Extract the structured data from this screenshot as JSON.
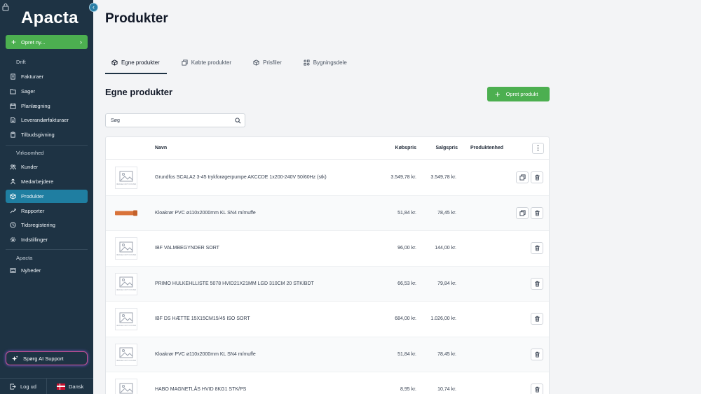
{
  "sidebar": {
    "logo": "Apacta",
    "collapse_glyph": "‹",
    "create_label": "Opret ny...",
    "sections": [
      {
        "label": "Drift"
      },
      {
        "label": "Virksomhed"
      },
      {
        "label": "Apacta"
      }
    ],
    "items": [
      {
        "label": "Fakturaer",
        "icon": "invoice-icon"
      },
      {
        "label": "Sager",
        "icon": "folder-icon"
      },
      {
        "label": "Planlægning",
        "icon": "calendar-icon"
      },
      {
        "label": "Leverandørfakturaer",
        "icon": "document-icon"
      },
      {
        "label": "Tilbudsgivning",
        "icon": "clipboard-icon"
      },
      {
        "label": "Kunder",
        "icon": "users-icon"
      },
      {
        "label": "Medarbejdere",
        "icon": "team-icon"
      },
      {
        "label": "Produkter",
        "icon": "box-icon",
        "active": true
      },
      {
        "label": "Rapporter",
        "icon": "trend-icon"
      },
      {
        "label": "Tidsregistering",
        "icon": "clock-icon"
      },
      {
        "label": "Indstillinger",
        "icon": "gear-icon"
      },
      {
        "label": "Nyheder",
        "icon": "news-icon"
      }
    ],
    "ai_support_label": "Spørg AI Support",
    "logout_label": "Log ud",
    "language_label": "Dansk"
  },
  "main": {
    "page_title": "Produkter",
    "tabs": [
      {
        "label": "Egne produkter",
        "icon": "cube-icon",
        "active": true
      },
      {
        "label": "Købte produkter",
        "icon": "copy-icon"
      },
      {
        "label": "Prisfiler",
        "icon": "cube-outline-icon"
      },
      {
        "label": "Bygningsdele",
        "icon": "grid-icon"
      }
    ],
    "section_title": "Egne produkter",
    "create_product_label": "Opret produkt",
    "search_placeholder": "Søg",
    "table": {
      "headers": {
        "name": "Navn",
        "purchase": "Købspris",
        "sale": "Salgspris",
        "unit": "Produktenhed",
        "more": "⋮"
      },
      "rows": [
        {
          "name": "Grundfos SCALA2 3-45 trykforøgerpumpe AKCCDE 1x200-240V 50/60Hz (stk)",
          "purchase": "3.549,78 kr.",
          "sale": "3.549,78 kr.",
          "thumb": "placeholder",
          "copy": true
        },
        {
          "name": "Kloakrør PVC ø110x2000mm KL SN4 m/muffe",
          "purchase": "51,84 kr.",
          "sale": "78,45 kr.",
          "thumb": "pipe",
          "copy": true
        },
        {
          "name": "IBF VALMBEGYNDER SORT",
          "purchase": "96,00 kr.",
          "sale": "144,00 kr.",
          "thumb": "placeholder",
          "copy": false
        },
        {
          "name": "PRIMO HULKEHLLISTE 5078 HVID21X21MM LGD 310CM 20 STK/BDT",
          "purchase": "66,53 kr.",
          "sale": "79,84 kr.",
          "thumb": "placeholder",
          "copy": false
        },
        {
          "name": "IBF DS HÆTTE 15X15CM15/45 ISO SORT",
          "purchase": "684,00 kr.",
          "sale": "1.026,00 kr.",
          "thumb": "placeholder",
          "copy": false
        },
        {
          "name": "Kloakrør PVC ø110x2000mm KL SN4 m/muffe",
          "purchase": "51,84 kr.",
          "sale": "78,45 kr.",
          "thumb": "placeholder",
          "copy": false
        },
        {
          "name": "HABO MAGNETLÅS HVID 8KG1 STK/PS",
          "purchase": "8,95 kr.",
          "sale": "10,74 kr.",
          "thumb": "placeholder",
          "copy": false
        }
      ]
    }
  },
  "colors": {
    "sidebar_bg": "#1e3344",
    "active_item": "#1f7ea1",
    "primary_green": "#4caf50"
  }
}
